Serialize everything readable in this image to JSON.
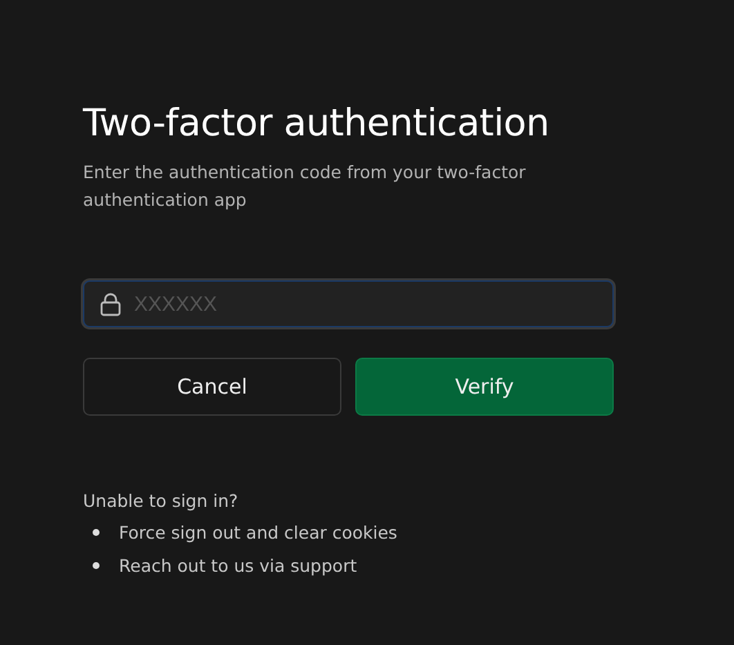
{
  "title": "Two-factor authentication",
  "description": "Enter the authentication code from your two-factor authentication app",
  "code_field": {
    "placeholder": "XXXXXX",
    "focused": true
  },
  "buttons": [
    {
      "label": "Cancel",
      "kind": "secondary"
    },
    {
      "label": "Verify",
      "kind": "primary"
    }
  ],
  "help": {
    "heading": "Unable to sign in?",
    "links": [
      "Force sign out and clear cookies",
      "Reach out to us via support"
    ]
  }
}
